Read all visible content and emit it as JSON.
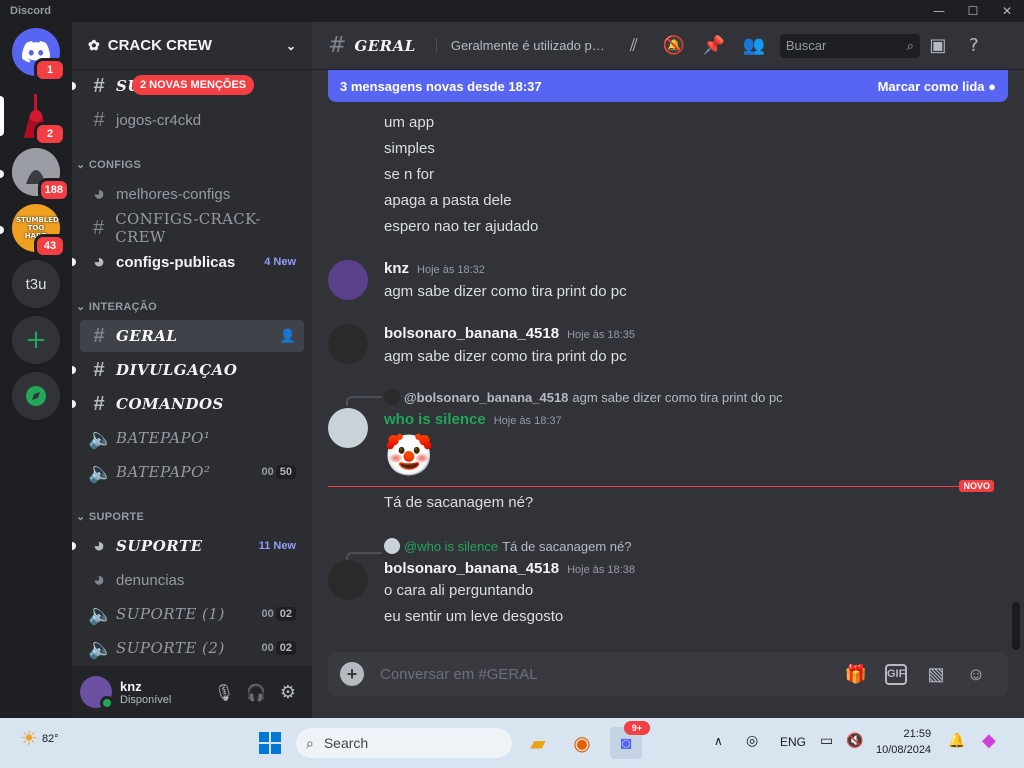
{
  "window": {
    "app_name": "Discord",
    "minimize": "—",
    "maximize": "☐",
    "close": "✕"
  },
  "servers": [
    {
      "name": "home",
      "badge": "1"
    },
    {
      "name": "red-server",
      "badge": "2"
    },
    {
      "name": "gray-server",
      "badge": "188"
    },
    {
      "name": "stumbled-server",
      "badge": "43",
      "logo_text": "STUMBLED TOO HARD"
    },
    {
      "name": "t3u",
      "label": "t3u"
    }
  ],
  "guild": {
    "name": "CRACK CREW"
  },
  "mentions_pill": "2 NOVAS MENÇÕES",
  "channels": {
    "top": [
      {
        "name": "SU",
        "kind": "text"
      },
      {
        "name": "jogos-cr4ckd",
        "kind": "text"
      }
    ],
    "configs_label": "CONFIGS",
    "configs": [
      {
        "name": "melhores-configs"
      },
      {
        "name": "CONFIGS-CRACK-CREW"
      },
      {
        "name": "configs-publicas",
        "badge": "4 New"
      }
    ],
    "interacao_label": "INTERAÇÃO",
    "interacao": [
      {
        "name": "GERAL"
      },
      {
        "name": "DIVULGAÇAO"
      },
      {
        "name": "COMANDOS"
      },
      {
        "name": "BATEPAPO¹"
      },
      {
        "name": "BATEPAPO²",
        "voice_a": "00",
        "voice_b": "50"
      }
    ],
    "suporte_label": "SUPORTE",
    "suporte": [
      {
        "name": "SUPORTE",
        "badge": "11 New"
      },
      {
        "name": "denuncias"
      },
      {
        "name": "SUPORTE (1)",
        "voice_a": "00",
        "voice_b": "02"
      },
      {
        "name": "SUPORTE (2)",
        "voice_a": "00",
        "voice_b": "02"
      }
    ]
  },
  "user": {
    "name": "knz",
    "status": "Disponível"
  },
  "header": {
    "channel": "GERAL",
    "topic": "Geralmente é utilizado par...",
    "search_placeholder": "Buscar"
  },
  "banner": {
    "text": "3 mensagens novas desde 18:37",
    "action": "Marcar como lida"
  },
  "messages": {
    "continued": [
      "um app",
      "simples",
      "se n for",
      "apaga a pasta dele",
      "espero nao ter ajudado"
    ],
    "m1": {
      "author": "knz",
      "time": "Hoje às 18:32",
      "text": "agm sabe dizer como tira print do pc"
    },
    "m2": {
      "author": "bolsonaro_banana_4518",
      "time": "Hoje às 18:35",
      "text": "agm sabe dizer como tira print do pc"
    },
    "m3": {
      "reply_author": "@bolsonaro_banana_4518",
      "reply_text": "agm sabe dizer como tira print do pc",
      "author": "who is silence",
      "time": "Hoje às 18:37",
      "emoji": "🤡"
    },
    "new_label": "NOVO",
    "m3b": "Tá de sacanagem né?",
    "m4": {
      "reply_author": "@who is silence",
      "reply_text": "Tá de sacanagem né?",
      "author": "bolsonaro_banana_4518",
      "time": "Hoje às 18:38",
      "lines": [
        "o cara ali perguntando",
        "eu sentir um leve desgosto"
      ]
    }
  },
  "composer": {
    "placeholder": "Conversar em #GERAL",
    "gif": "GIF"
  },
  "taskbar": {
    "weather": "82°",
    "search": "Search",
    "lang": "ENG",
    "time": "21:59",
    "date": "10/08/2024",
    "discord_badge": "9+"
  },
  "colors": {
    "blurple": "#5865f2",
    "red": "#f23f43",
    "green_name": "#23a55a"
  }
}
